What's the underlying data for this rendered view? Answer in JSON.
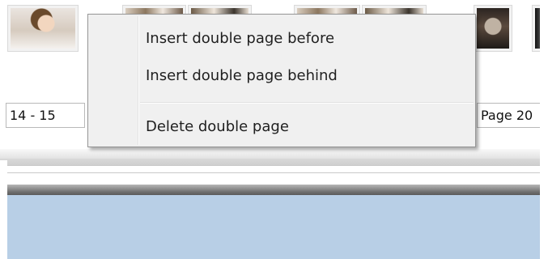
{
  "pagination": {
    "left_field_value": "14 - 15",
    "right_field_value": "Page 20"
  },
  "thumbnails": [
    {
      "icon": "photo-bride-thumbnail"
    },
    {
      "icon": "photo-wedding-thumbnail"
    },
    {
      "icon": "photo-wedding-thumbnail"
    },
    {
      "icon": "photo-wedding-thumbnail"
    },
    {
      "icon": "photo-wedding-thumbnail"
    },
    {
      "icon": "photo-wedding-thumbnail"
    },
    {
      "icon": "photo-wedding-thumbnail"
    }
  ],
  "context_menu": {
    "items": [
      {
        "label": "Insert double page before"
      },
      {
        "label": "Insert double page behind"
      },
      {
        "label": "Delete double page"
      }
    ]
  },
  "colors": {
    "workspace_blue": "#b8cfe6",
    "menu_background": "#f0f0f0"
  }
}
